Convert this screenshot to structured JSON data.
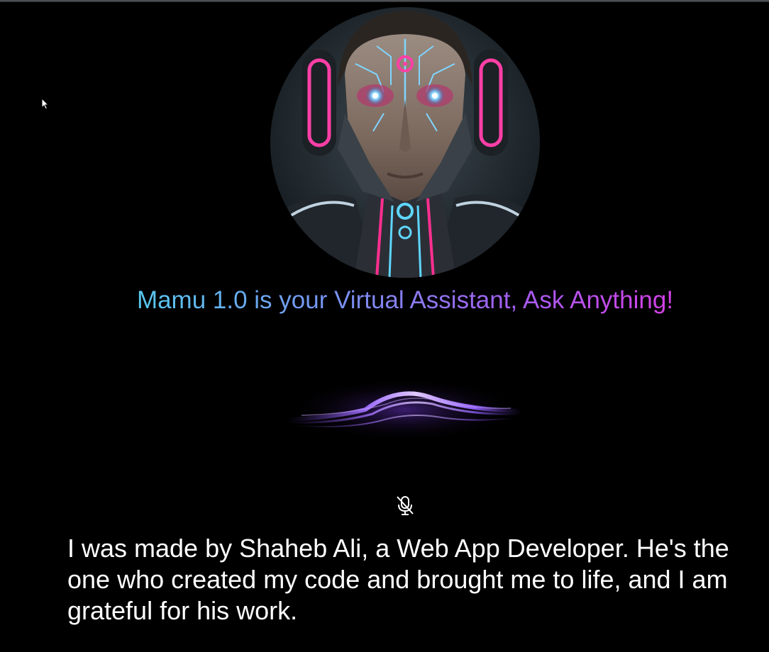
{
  "assistant": {
    "name": "Mamu 1.0",
    "avatar_icon": "robot-avatar-icon",
    "tagline": "Mamu 1.0 is your Virtual Assistant, Ask Anything!",
    "tagline_gradient": [
      "#57c8ee",
      "#7a8ef0",
      "#a35ef0",
      "#d33fe6"
    ]
  },
  "voice": {
    "wave_icon": "voice-wave-icon",
    "wave_color": "#9a5cf5",
    "mic_icon": "mic-off-icon"
  },
  "response": {
    "text": "I was made by Shaheb Ali, a Web App Developer. He's the one who created my code and brought me to life, and I am grateful for his work."
  },
  "colors": {
    "background": "#000000",
    "text": "#ffffff"
  }
}
